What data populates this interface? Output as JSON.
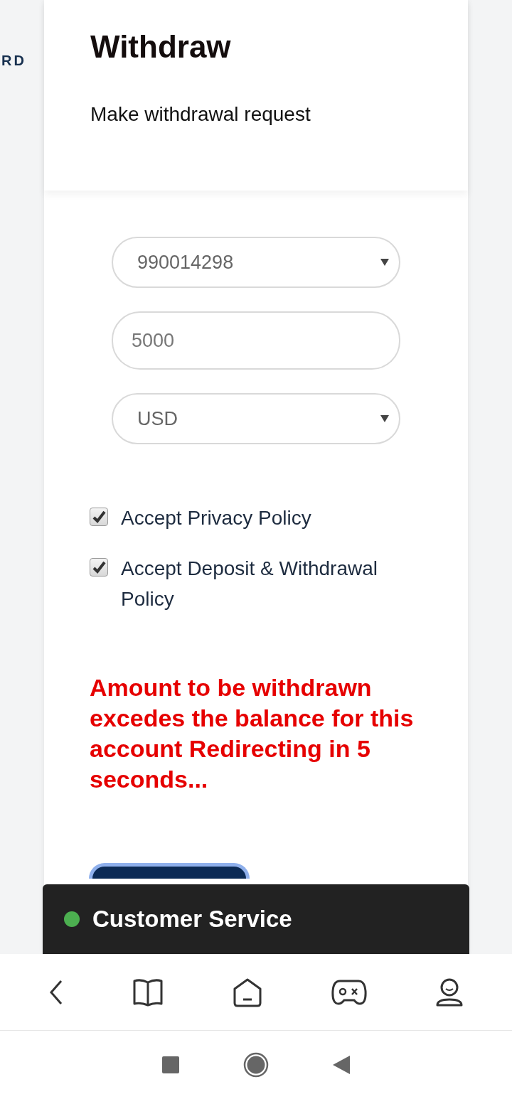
{
  "side_text": "RD",
  "header": {
    "title": "Withdraw",
    "subtitle": "Make withdrawal request"
  },
  "fields": [
    {
      "kind": "select",
      "value": "990014298"
    },
    {
      "kind": "input",
      "value": "5000"
    },
    {
      "kind": "select",
      "value": "USD"
    }
  ],
  "checkboxes": [
    {
      "label": "Accept Privacy Policy",
      "checked": true
    },
    {
      "label": "Accept Deposit & Withdrawal Policy",
      "checked": true
    }
  ],
  "error": "Amount to be withdrawn excedes the balance for this account Redirecting in 5 seconds...",
  "chat_bar": {
    "label": "Customer Service",
    "online": true
  }
}
